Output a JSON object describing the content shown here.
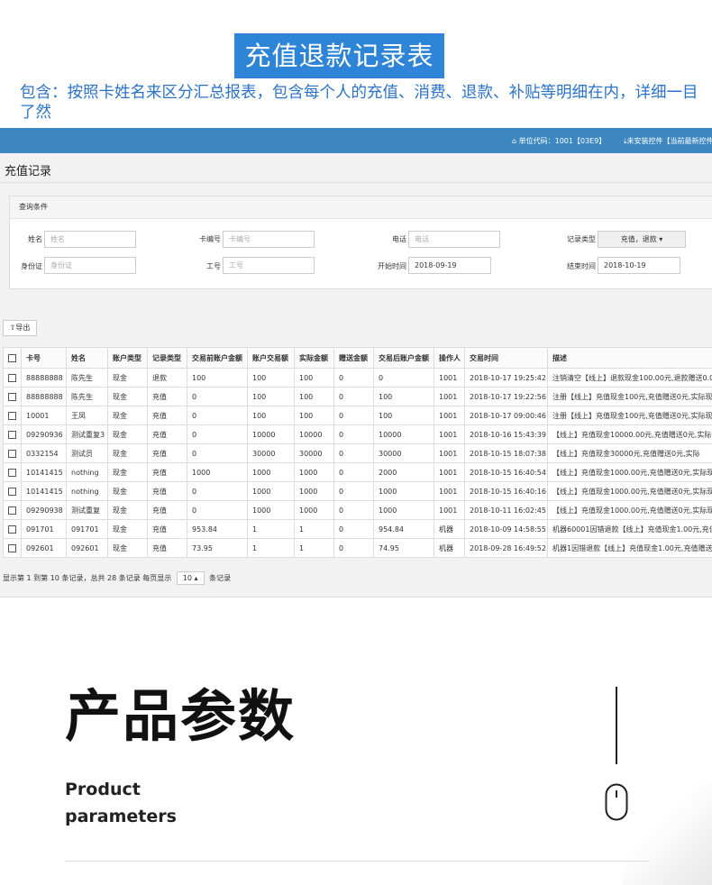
{
  "banner": {
    "title": "充值退款记录表",
    "description": "包含：按照卡姓名来区分汇总报表，包含每个人的充值、消费、退款、补贴等明细在内，详细一目了然"
  },
  "topbar": {
    "unit_code": "单位代码：1001【03E9】",
    "control": "未安装控件【当前最新控件"
  },
  "page": {
    "title": "充值记录"
  },
  "query": {
    "heading": "查询条件",
    "name_label": "姓名",
    "name_placeholder": "姓名",
    "card_label": "卡编号",
    "card_placeholder": "卡编号",
    "phone_label": "电话",
    "phone_placeholder": "电话",
    "type_label": "记录类型",
    "type_value": "充值，退款",
    "id_label": "身份证",
    "id_placeholder": "身份证",
    "worker_label": "工号",
    "worker_placeholder": "工号",
    "start_label": "开始时间",
    "start_value": "2018-09-19",
    "end_label": "结束时间",
    "end_value": "2018-10-19"
  },
  "toolbar": {
    "export_label": "导出"
  },
  "table": {
    "columns": [
      "卡号",
      "姓名",
      "账户类型",
      "记录类型",
      "交易前账户金额",
      "账户交易额",
      "实际金额",
      "赠送金额",
      "交易后账户金额",
      "操作人",
      "交易时间",
      "描述"
    ],
    "rows": [
      [
        "88888888",
        "陈先生",
        "现金",
        "退款",
        "100",
        "100",
        "100",
        "0",
        "0",
        "1001",
        "2018-10-17 19:25:42",
        "注销清空【线上】退款现金100.00元,退款赠送0.0"
      ],
      [
        "88888888",
        "陈先生",
        "现金",
        "充值",
        "0",
        "100",
        "100",
        "0",
        "100",
        "1001",
        "2018-10-17 19:22:56",
        "注册【线上】充值现金100元,充值赠送0元,实际现"
      ],
      [
        "10001",
        "王凤",
        "现金",
        "充值",
        "0",
        "100",
        "100",
        "0",
        "100",
        "1001",
        "2018-10-17 09:00:46",
        "注册【线上】充值现金100元,充值赠送0元,实际现"
      ],
      [
        "09290936",
        "测试重复3",
        "现金",
        "充值",
        "0",
        "10000",
        "10000",
        "0",
        "10000",
        "1001",
        "2018-10-16 15:43:39",
        "【线上】充值现金10000.00元,充值赠送0元,实际"
      ],
      [
        "0332154",
        "测试员",
        "现金",
        "充值",
        "0",
        "30000",
        "30000",
        "0",
        "30000",
        "1001",
        "2018-10-15 18:07:38",
        "【线上】充值现金30000元,充值赠送0元,实际"
      ],
      [
        "10141415",
        "nothing",
        "现金",
        "充值",
        "1000",
        "1000",
        "1000",
        "0",
        "2000",
        "1001",
        "2018-10-15 16:40:54",
        "【线上】充值现金1000.00元,充值赠送0元,实际现"
      ],
      [
        "10141415",
        "nothing",
        "现金",
        "充值",
        "0",
        "1000",
        "1000",
        "0",
        "1000",
        "1001",
        "2018-10-15 16:40:16",
        "【线上】充值现金1000.00元,充值赠送0元,实际现"
      ],
      [
        "09290938",
        "测试重复",
        "现金",
        "充值",
        "0",
        "1000",
        "1000",
        "0",
        "1000",
        "1001",
        "2018-10-11 16:02:45",
        "【线上】充值现金1000.00元,充值赠送0元,实际现"
      ],
      [
        "091701",
        "091701",
        "现金",
        "充值",
        "953.84",
        "1",
        "1",
        "0",
        "954.84",
        "机器",
        "2018-10-09 14:58:55",
        "机器60001因错退款【线上】充值现金1.00元,充值"
      ],
      [
        "092601",
        "092601",
        "现金",
        "充值",
        "73.95",
        "1",
        "1",
        "0",
        "74.95",
        "机器",
        "2018-09-28 16:49:52",
        "机器1因错退款【线上】充值现金1.00元,充值赠送"
      ]
    ]
  },
  "pager": {
    "summary": "显示第 1 到第 10 条记录，总共 28 条记录 每页显示",
    "page_size": "10",
    "suffix": "条记录"
  },
  "params": {
    "title": "产品参数",
    "english_line1": "Product",
    "english_line2": "parameters"
  }
}
